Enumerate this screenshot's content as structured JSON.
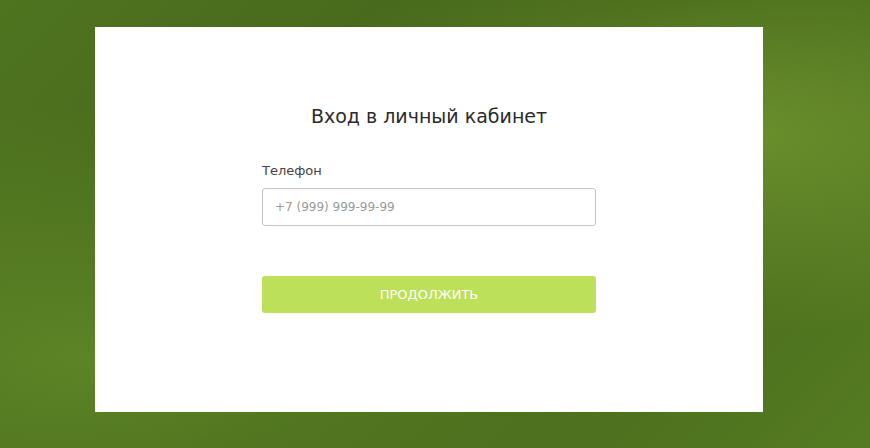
{
  "page": {
    "title": "Вход в личный кабинет"
  },
  "form": {
    "fields": [
      {
        "label": "Телефон",
        "placeholder": "+7 (999) 999-99-99",
        "value": ""
      }
    ],
    "submit": {
      "label": "ПРОДОЛЖИТЬ",
      "disabled": false
    }
  }
}
